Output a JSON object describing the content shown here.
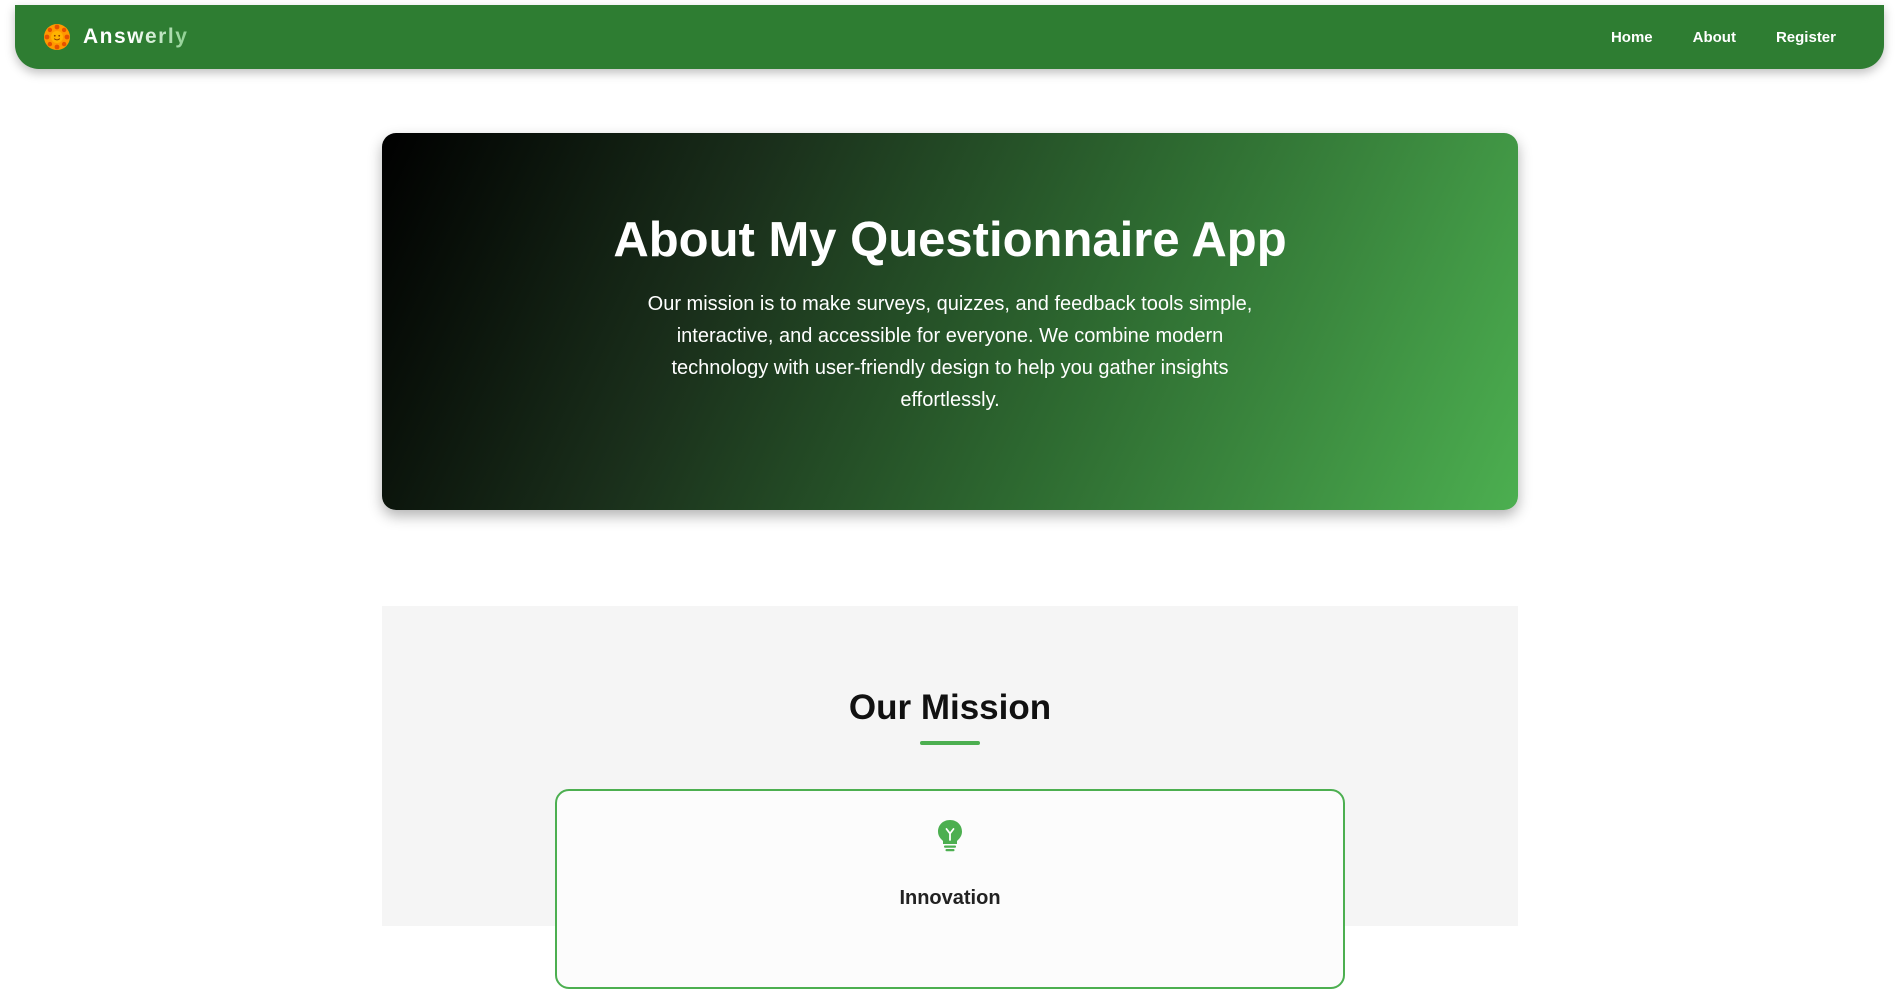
{
  "navbar": {
    "brand": "Answerly",
    "links": [
      "Home",
      "About",
      "Register"
    ]
  },
  "hero": {
    "title": "About My Questionnaire App",
    "description": "Our mission is to make surveys, quizzes, and feedback tools simple, interactive, and accessible for everyone. We combine modern technology with user-friendly design to help you gather insights effortlessly."
  },
  "mission": {
    "heading": "Our Mission",
    "cards": [
      {
        "icon": "lightbulb-icon",
        "title": "Innovation"
      }
    ]
  },
  "colors": {
    "primary": "#2e7d32",
    "accent": "#4caf50",
    "logo": "#ff9800"
  }
}
